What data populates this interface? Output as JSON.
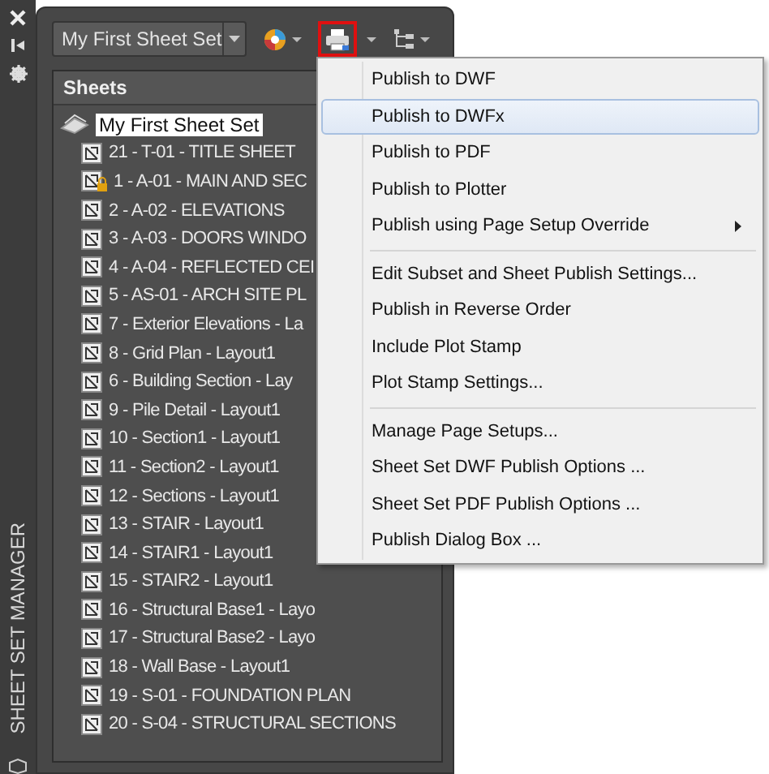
{
  "palette": {
    "title": "SHEET SET MANAGER"
  },
  "toolbar": {
    "sheet_set": "My First Sheet Set",
    "publish_selected": true
  },
  "sheets": {
    "header": "Sheets",
    "root": {
      "label": "My First Sheet Set",
      "selected": true
    },
    "children": [
      {
        "label": "21 - T-01 - TITLE SHEET",
        "locked": false
      },
      {
        "label": "1 - A-01 - MAIN AND SEC",
        "locked": true
      },
      {
        "label": "2 - A-02 - ELEVATIONS",
        "locked": false
      },
      {
        "label": "3 - A-03 - DOORS WINDO",
        "locked": false
      },
      {
        "label": "4 - A-04 - REFLECTED CEI",
        "locked": false
      },
      {
        "label": "5 - AS-01 - ARCH SITE PL",
        "locked": false
      },
      {
        "label": "7 - Exterior Elevations - La",
        "locked": false
      },
      {
        "label": "8 - Grid Plan - Layout1",
        "locked": false
      },
      {
        "label": "6 - Building Section - Lay",
        "locked": false
      },
      {
        "label": "9 - Pile Detail - Layout1",
        "locked": false
      },
      {
        "label": "10 - Section1 - Layout1",
        "locked": false
      },
      {
        "label": "11 - Section2 - Layout1",
        "locked": false
      },
      {
        "label": "12 - Sections - Layout1",
        "locked": false
      },
      {
        "label": "13 - STAIR - Layout1",
        "locked": false
      },
      {
        "label": "14 - STAIR1 - Layout1",
        "locked": false
      },
      {
        "label": "15 - STAIR2 - Layout1",
        "locked": false
      },
      {
        "label": "16 - Structural Base1 - Layo",
        "locked": false
      },
      {
        "label": "17 - Structural Base2 - Layo",
        "locked": false
      },
      {
        "label": "18 - Wall Base - Layout1",
        "locked": false
      },
      {
        "label": "19 - S-01 - FOUNDATION PLAN",
        "locked": false
      },
      {
        "label": "20 - S-04 - STRUCTURAL SECTIONS",
        "locked": false
      }
    ]
  },
  "menu": {
    "groups": [
      [
        {
          "label": "Publish to DWF",
          "selected": false,
          "submenu": false
        },
        {
          "label": "Publish to DWFx",
          "selected": true,
          "submenu": false
        },
        {
          "label": "Publish to PDF",
          "selected": false,
          "submenu": false
        },
        {
          "label": "Publish to Plotter",
          "selected": false,
          "submenu": false
        },
        {
          "label": "Publish using Page Setup Override",
          "selected": false,
          "submenu": true
        }
      ],
      [
        {
          "label": "Edit Subset and Sheet Publish Settings...",
          "selected": false,
          "submenu": false
        },
        {
          "label": "Publish in Reverse Order",
          "selected": false,
          "submenu": false
        },
        {
          "label": "Include Plot Stamp",
          "selected": false,
          "submenu": false
        },
        {
          "label": "Plot Stamp Settings...",
          "selected": false,
          "submenu": false
        }
      ],
      [
        {
          "label": "Manage Page Setups...",
          "selected": false,
          "submenu": false
        },
        {
          "label": "Sheet Set DWF Publish Options ...",
          "selected": false,
          "submenu": false
        },
        {
          "label": "Sheet Set PDF Publish Options ...",
          "selected": false,
          "submenu": false
        },
        {
          "label": "Publish Dialog Box ...",
          "selected": false,
          "submenu": false
        }
      ]
    ]
  }
}
